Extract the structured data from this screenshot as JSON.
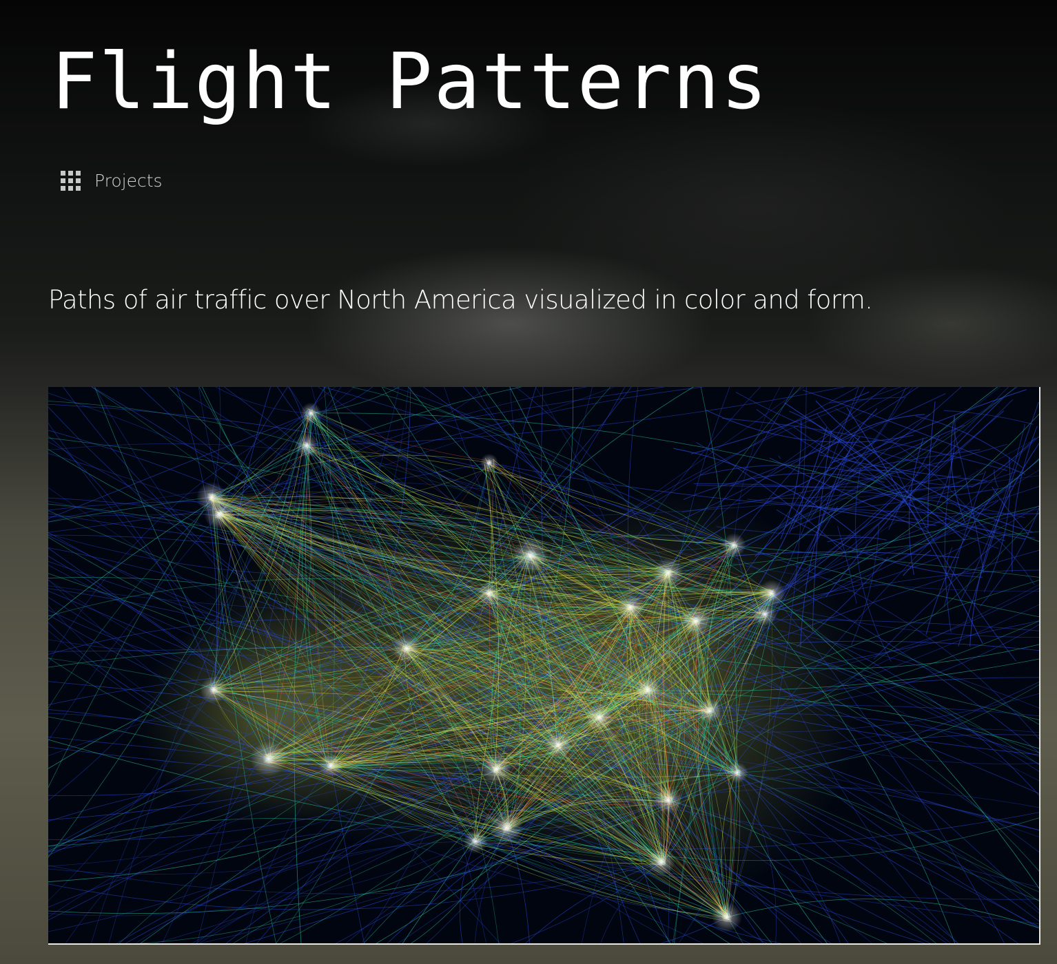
{
  "header": {
    "title": "Flight Patterns"
  },
  "nav": {
    "projects_label": "Projects",
    "icon": "grid-icon"
  },
  "intro": {
    "description": "Paths of air traffic over North America visualized in color and form."
  },
  "visualization": {
    "alt": "Flight paths over North America",
    "colors": {
      "background": "#000510",
      "low_density": "#2a4ad8",
      "medium": "#27c8a0",
      "high": "#d9f04a",
      "peak": "#ffd24a",
      "accent": "#ff5a3c",
      "hub": "#ffffff"
    }
  }
}
